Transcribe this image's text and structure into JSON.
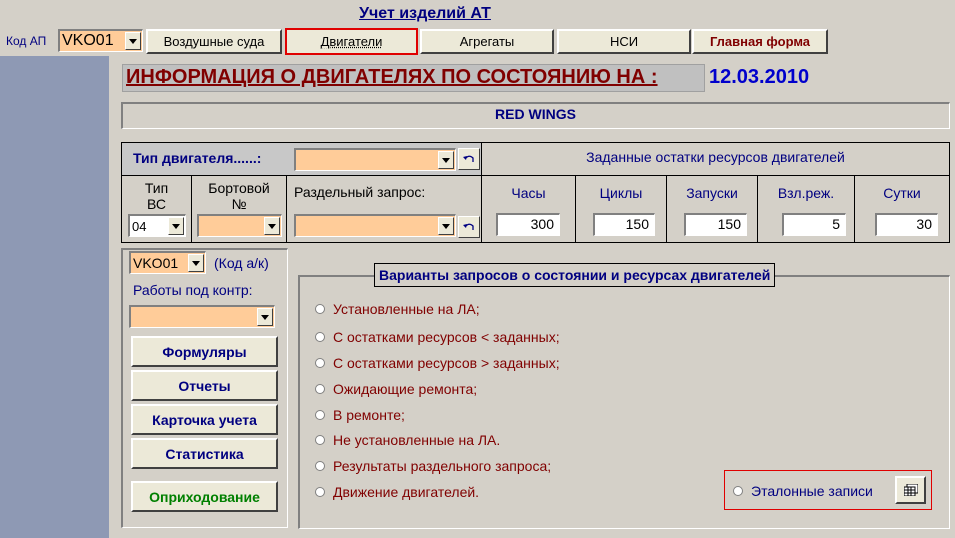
{
  "app_title": "Учет изделий АТ",
  "top": {
    "kod_ap_label": "Код АП",
    "kod_ap_value": "VKO01",
    "tabs": [
      "Воздушные суда",
      "Двигатели",
      "Агрегаты",
      "НСИ",
      "Главная форма"
    ]
  },
  "main": {
    "heading": "ИНФОРМАЦИЯ О ДВИГАТЕЛЯХ ПО СОСТОЯНИЮ НА :",
    "date": "12.03.2010",
    "company": "RED WINGS",
    "engine_type_label": "Тип двигателя......:",
    "engine_type_value": "",
    "split_query_label": "Раздельный запрос:",
    "split_query_value": "",
    "vs_type_label_1": "Тип",
    "vs_type_label_2": "ВС",
    "vs_type_value": "04",
    "board_label_1": "Бортовой",
    "board_label_2": "№",
    "board_value": "",
    "resources_header": "Заданные остатки ресурсов двигателей",
    "resource_cols": [
      {
        "label": "Часы",
        "value": "300"
      },
      {
        "label": "Циклы",
        "value": "150"
      },
      {
        "label": "Запуски",
        "value": "150"
      },
      {
        "label": "Взл.реж.",
        "value": "5"
      },
      {
        "label": "Сутки",
        "value": "30"
      }
    ]
  },
  "left": {
    "ak_value": "VKO01",
    "ak_label": "(Код а/к)",
    "works_label": "Работы под контр:",
    "works_value": "",
    "buttons": [
      "Формуляры",
      "Отчеты",
      "Карточка учета",
      "Статистика"
    ],
    "oprih_button": "Оприходование"
  },
  "options": {
    "title": "Варианты запросов о состоянии и ресурсах двигателей",
    "items": [
      "Установленные на ЛА;",
      "С остатками ресурсов < заданных;",
      "С остатками ресурсов > заданных;",
      "Ожидающие ремонта;",
      "В ремонте;",
      "Не установленные на ЛА.",
      "Результаты раздельного запроса;",
      "Движение двигателей."
    ],
    "etalon_label": "Эталонные записи"
  },
  "colors": {
    "background": "#d4d0c8",
    "left_strip": "#8e99b4",
    "heading": "#800000",
    "date": "#0000cc",
    "navy": "#000080",
    "peach": "#ffcc99",
    "green_button": "#008000",
    "highlight_red": "#e00000"
  },
  "icons": {
    "dropdown": "chevron-down-icon",
    "undo": "undo-icon",
    "etalon": "table-icon"
  }
}
